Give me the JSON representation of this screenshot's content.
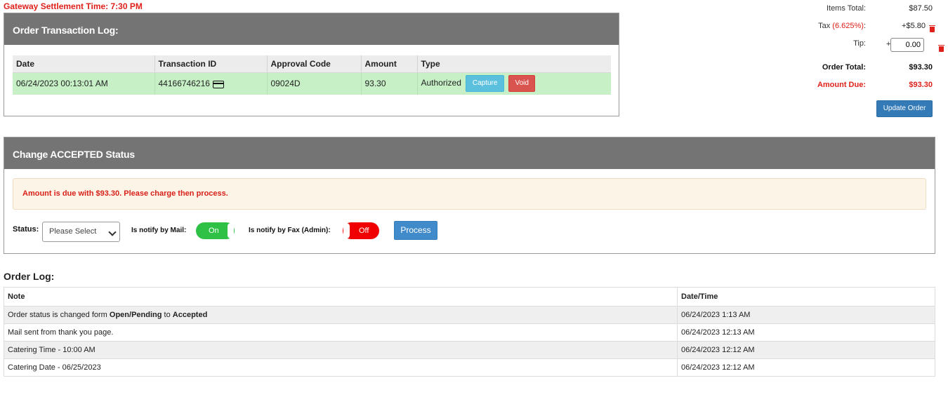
{
  "settlement": "Gateway Settlement Time: 7:30 PM",
  "transaction_log": {
    "title": "Order Transaction Log:",
    "columns": [
      "Date",
      "Transaction ID",
      "Approval Code",
      "Amount",
      "Type"
    ],
    "rows": [
      {
        "date": "06/24/2023 00:13:01 AM",
        "transaction_id": "44166746216",
        "approval_code": "09024D",
        "amount": "93.30",
        "type": "Authorized",
        "capture_label": "Capture",
        "void_label": "Void"
      }
    ]
  },
  "totals": {
    "items_total_label": "Items Total:",
    "items_total_value": "$87.50",
    "tax_label": "Tax",
    "tax_rate": "(6.625%)",
    "tax_colon": ":",
    "tax_value": "+$5.80",
    "tip_label": "Tip:",
    "tip_prefix": "+",
    "tip_value": "0.00",
    "order_total_label": "Order Total:",
    "order_total_value": "$93.30",
    "amount_due_label": "Amount Due:",
    "amount_due_value": "$93.30",
    "update_button": "Update Order"
  },
  "status_panel": {
    "title": "Change ACCEPTED Status",
    "alert": "Amount is due with $93.30. Please charge then process.",
    "status_label": "Status:",
    "status_selected": "Please Select",
    "mail_label": "Is notify by Mail:",
    "mail_toggle": "On",
    "fax_label": "Is notify by Fax (Admin):",
    "fax_toggle": "Off",
    "process_button": "Process"
  },
  "order_log": {
    "title": "Order Log:",
    "columns": [
      "Note",
      "Date/Time"
    ],
    "rows": [
      {
        "note_pre": "Order status is changed form ",
        "note_b1": "Open/Pending",
        "note_mid": " to ",
        "note_b2": "Accepted",
        "datetime": "06/24/2023 1:13 AM"
      },
      {
        "note_pre": "Mail sent from thank you page.",
        "note_b1": "",
        "note_mid": "",
        "note_b2": "",
        "datetime": "06/24/2023 12:13 AM"
      },
      {
        "note_pre": "Catering Time - 10:00 AM",
        "note_b1": "",
        "note_mid": "",
        "note_b2": "",
        "datetime": "06/24/2023 12:12 AM"
      },
      {
        "note_pre": "Catering Date - 06/25/2023",
        "note_b1": "",
        "note_mid": "",
        "note_b2": "",
        "datetime": "06/24/2023 12:12 AM"
      }
    ]
  },
  "colors": {
    "accent_red": "#e0201a",
    "panel_header": "#747474",
    "row_green": "#c7f0c7",
    "toggle_on": "#2fc046",
    "toggle_off": "#f00000",
    "button_blue": "#337ab7"
  }
}
